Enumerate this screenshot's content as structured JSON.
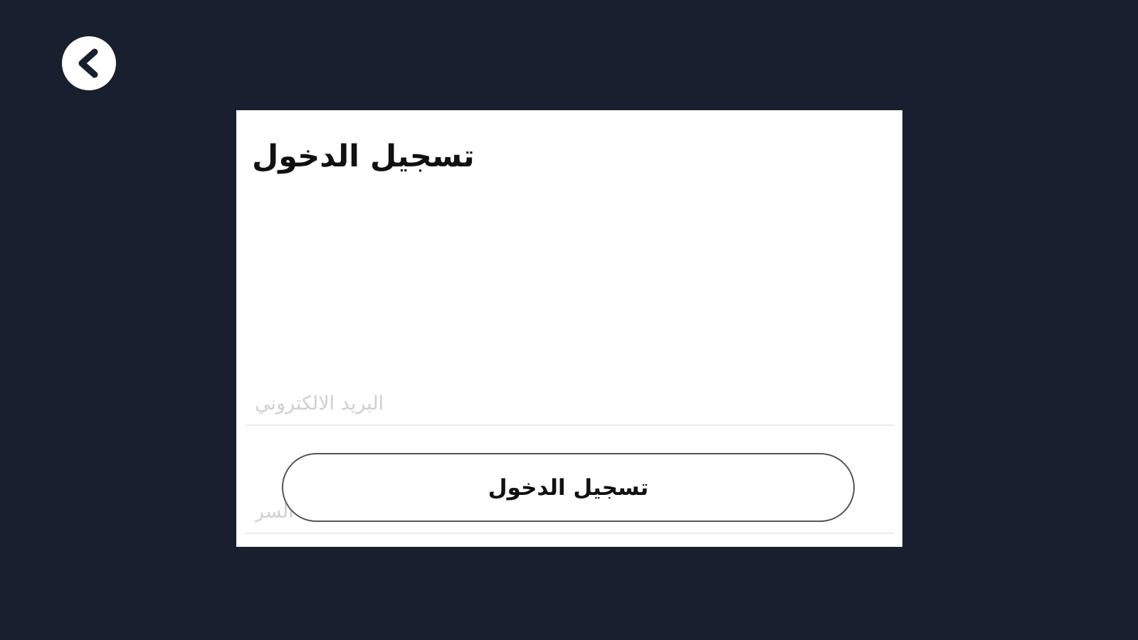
{
  "back": {
    "icon": "chevron-left-icon"
  },
  "form": {
    "title": "تسجيل الدخول",
    "email": {
      "value": "",
      "placeholder": "البريد الالكتروني"
    },
    "password": {
      "value": "",
      "placeholder": "كلمة السر"
    },
    "submit_label": "تسجيل الدخول"
  },
  "colors": {
    "background": "#181f2f",
    "card": "#ffffff",
    "text": "#111111",
    "placeholder": "#cfcfcf"
  }
}
